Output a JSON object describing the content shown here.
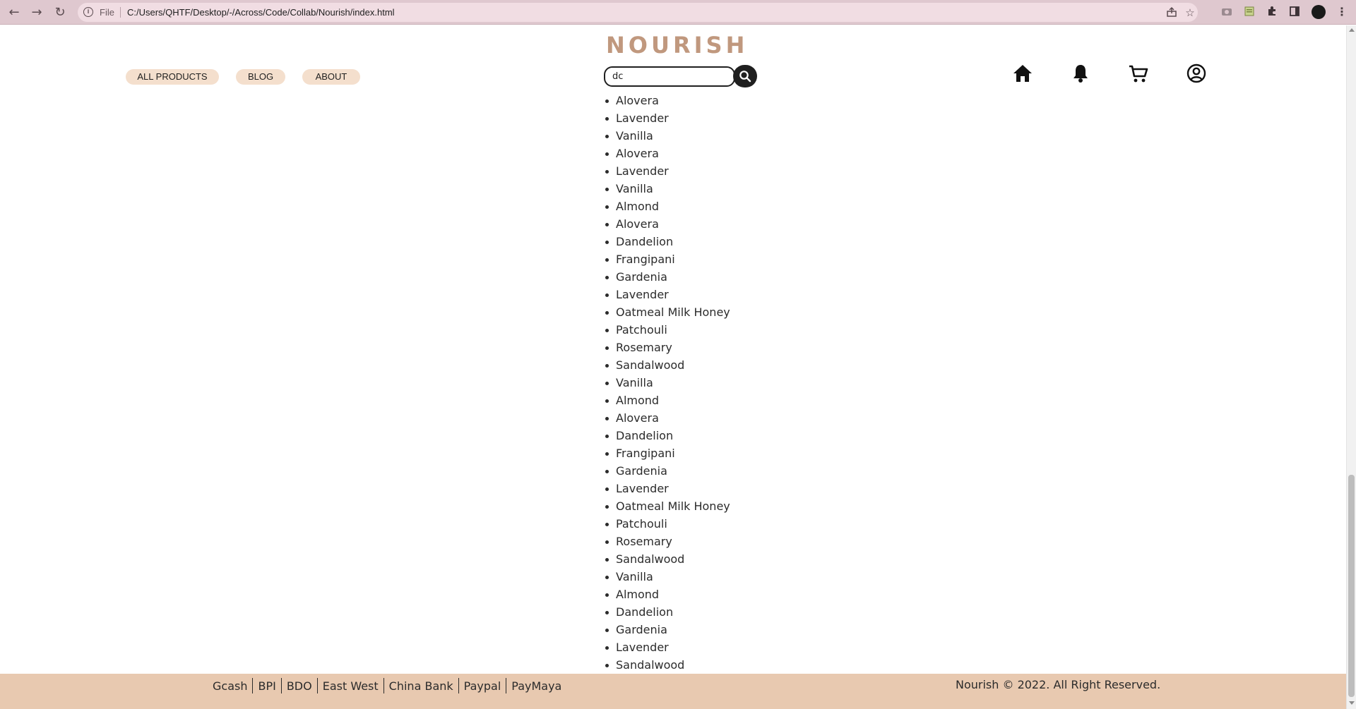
{
  "browser": {
    "file_label": "File",
    "url": "C:/Users/QHTF/Desktop/-/Across/Code/Collab/Nourish/index.html",
    "icons": [
      "back-icon",
      "forward-icon",
      "reload-icon",
      "info-icon",
      "share-icon",
      "star-icon",
      "camera-icon",
      "extension-icon",
      "puzzle-icon",
      "sidebar-icon",
      "profile-icon",
      "menu-icon"
    ]
  },
  "header": {
    "logo": "NOURISH",
    "nav": [
      "ALL PRODUCTS",
      "BLOG",
      "ABOUT"
    ],
    "search": {
      "value": "dc"
    },
    "icons": [
      "home-icon",
      "bell-icon",
      "cart-icon",
      "user-icon"
    ]
  },
  "results": [
    "Alovera",
    "Lavender",
    "Vanilla",
    "Alovera",
    "Lavender",
    "Vanilla",
    "Almond",
    "Alovera",
    "Dandelion",
    "Frangipani",
    "Gardenia",
    "Lavender",
    "Oatmeal Milk Honey",
    "Patchouli",
    "Rosemary",
    "Sandalwood",
    "Vanilla",
    "Almond",
    "Alovera",
    "Dandelion",
    "Frangipani",
    "Gardenia",
    "Lavender",
    "Oatmeal Milk Honey",
    "Patchouli",
    "Rosemary",
    "Sandalwood",
    "Vanilla",
    "Almond",
    "Dandelion",
    "Gardenia",
    "Lavender",
    "Sandalwood"
  ],
  "footer": {
    "payments": [
      "Gcash",
      "BPI",
      "BDO",
      "East West",
      "China Bank",
      "Paypal",
      "PayMaya"
    ],
    "copyright": "Nourish © 2022. All Right Reserved."
  },
  "colors": {
    "chrome": "#dfc8cf",
    "logo": "#c0987e",
    "pill": "#f4dfcd",
    "footer": "#e8c9b0",
    "search_button": "#1f1f1f"
  }
}
